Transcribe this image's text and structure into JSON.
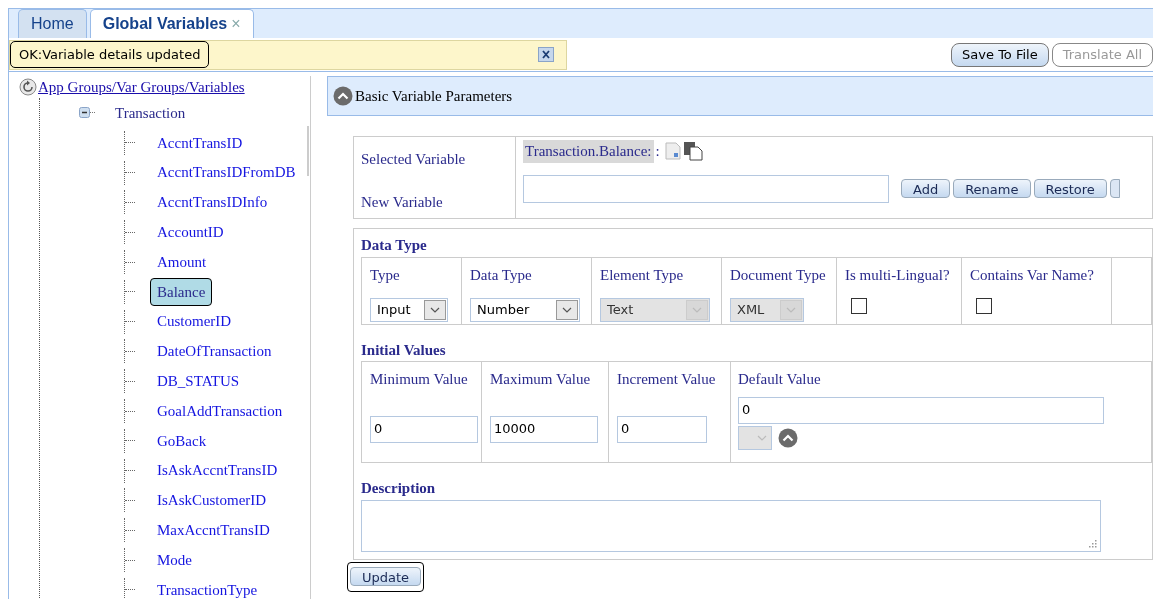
{
  "tabs": [
    {
      "label": "Home",
      "selected": false
    },
    {
      "label": "Global Variables",
      "selected": true,
      "close": "×"
    }
  ],
  "message": {
    "text": "OK:Variable details updated"
  },
  "toolbar": [
    {
      "label": "Save To File",
      "disabled": false
    },
    {
      "label": "Translate All",
      "disabled": true
    }
  ],
  "tree": {
    "root": "App Groups/Var Groups/Variables",
    "groups": [
      {
        "label": "Transaction",
        "expanded": true,
        "children": [
          {
            "label": "AccntTransID",
            "selected": false
          },
          {
            "label": "AccntTransIDFromDB",
            "selected": false
          },
          {
            "label": "AccntTransIDInfo",
            "selected": false
          },
          {
            "label": "AccountID",
            "selected": false
          },
          {
            "label": "Amount",
            "selected": false
          },
          {
            "label": "Balance",
            "selected": true
          },
          {
            "label": "CustomerID",
            "selected": false
          },
          {
            "label": "DateOfTransaction",
            "selected": false
          },
          {
            "label": "DB_STATUS",
            "selected": false
          },
          {
            "label": "GoalAddTransaction",
            "selected": false
          },
          {
            "label": "GoBack",
            "selected": false
          },
          {
            "label": "IsAskAccntTransID",
            "selected": false
          },
          {
            "label": "IsAskCustomerID",
            "selected": false
          },
          {
            "label": "MaxAccntTransID",
            "selected": false
          },
          {
            "label": "Mode",
            "selected": false
          },
          {
            "label": "TransactionType",
            "selected": false
          }
        ]
      }
    ]
  },
  "section": {
    "title": "Basic Variable Parameters",
    "expanded": true
  },
  "variable": {
    "selected_label": "Selected Variable",
    "selected_value": "Transaction.Balance:",
    "selected_suffix": ":",
    "new_label": "New Variable",
    "buttons": [
      "Add",
      "Rename",
      "Restore"
    ]
  },
  "data_type": {
    "title": "Data Type",
    "columns": [
      {
        "label": "Type",
        "kind": "select",
        "value": "Input",
        "disabled": false
      },
      {
        "label": "Data Type",
        "kind": "select",
        "value": "Number",
        "disabled": false
      },
      {
        "label": "Element Type",
        "kind": "select",
        "value": "Text",
        "disabled": true
      },
      {
        "label": "Document Type",
        "kind": "select",
        "value": "XML",
        "disabled": true
      },
      {
        "label": "Is multi-Lingual?",
        "kind": "checkbox",
        "checked": false
      },
      {
        "label": "Contains Var Name?",
        "kind": "checkbox",
        "checked": false
      }
    ]
  },
  "initial_values": {
    "title": "Initial Values",
    "fields": [
      {
        "label": "Minimum Value",
        "value": "0"
      },
      {
        "label": "Maximum Value",
        "value": "10000"
      },
      {
        "label": "Increment Value",
        "value": "0"
      }
    ],
    "default": {
      "label": "Default Value",
      "value": "0"
    }
  },
  "description": {
    "title": "Description"
  },
  "update_button": "Update"
}
